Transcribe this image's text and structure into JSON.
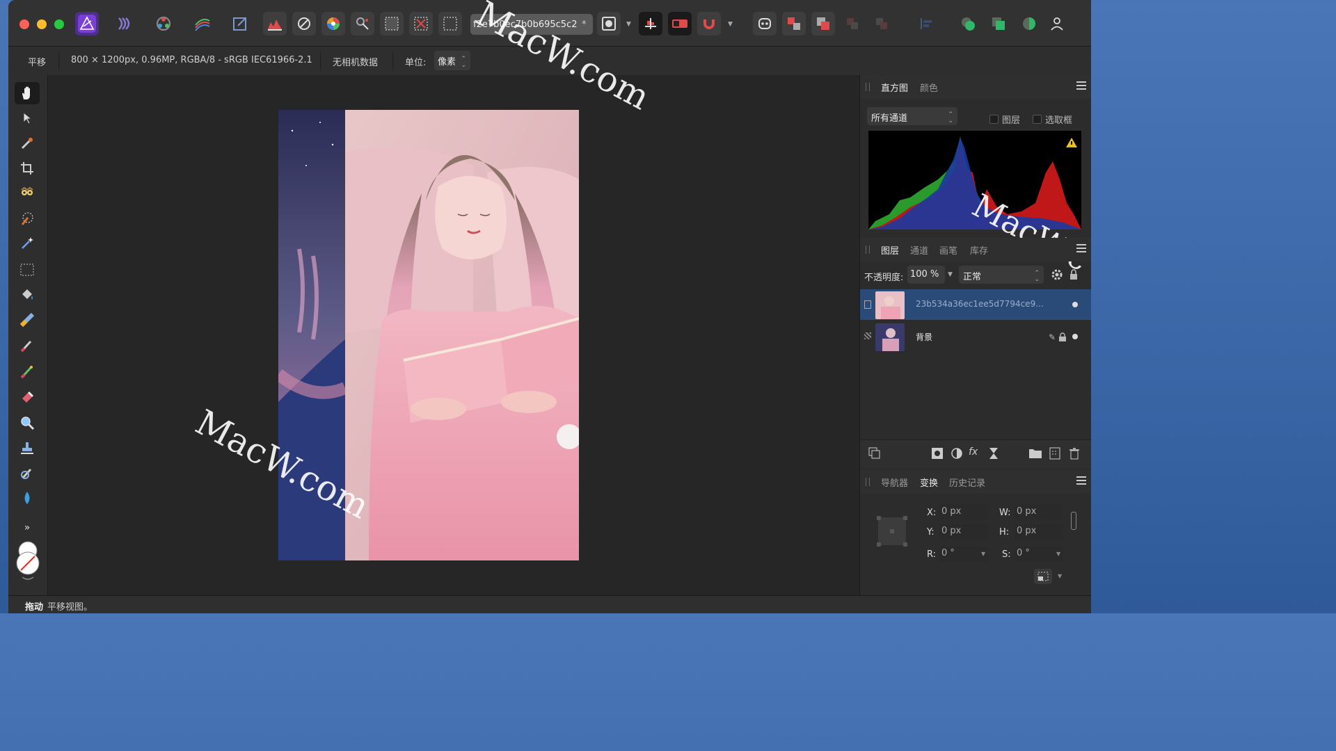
{
  "document": {
    "tab_title": "f2e7b0ec7b0b695c5c2",
    "tab_modified": "*"
  },
  "context": {
    "tool": "平移",
    "info": "800 × 1200px, 0.96MP, RGBA/8 - sRGB IEC61966-2.1",
    "camera": "无相机数据",
    "unit_label": "单位:",
    "unit_value": "像素"
  },
  "histogram_panel": {
    "tabs": [
      "直方图",
      "颜色"
    ],
    "channel": "所有通道",
    "check_layer": "图层",
    "check_selection": "选取框"
  },
  "layers_panel": {
    "tabs": [
      "图层",
      "通道",
      "画笔",
      "库存"
    ],
    "opacity_label": "不透明度:",
    "opacity_value": "100 %",
    "blend_mode": "正常",
    "layers": [
      {
        "name": "23b534a36ec1ee5d7794ce9..."
      },
      {
        "name": "背景"
      }
    ]
  },
  "transform_panel": {
    "tabs": [
      "导航器",
      "变换",
      "历史记录"
    ],
    "x_label": "X:",
    "x_value": "0 px",
    "y_label": "Y:",
    "y_value": "0 px",
    "w_label": "W:",
    "w_value": "0 px",
    "h_label": "H:",
    "h_value": "0 px",
    "r_label": "R:",
    "r_value": "0 °",
    "s_label": "S:",
    "s_value": "0 °"
  },
  "status": {
    "action": "拖动",
    "hint": "平移视图。"
  },
  "watermark": {
    "text1": "MacW.com",
    "text2": "MacW.com",
    "text3": "MacW.c"
  },
  "colors": {
    "accent": "#2a4a78",
    "app_icon": "#7b3fd6"
  }
}
